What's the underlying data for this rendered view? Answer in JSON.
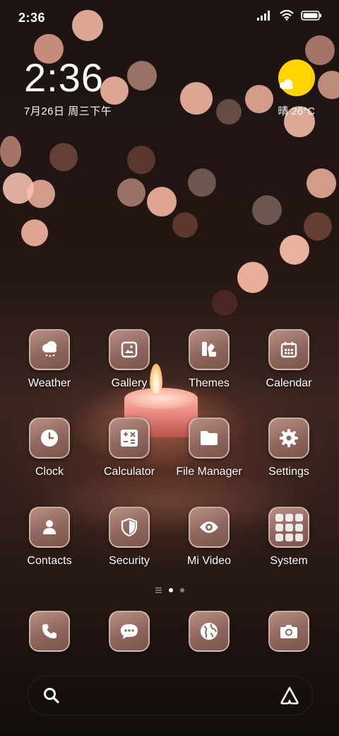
{
  "status_bar": {
    "time": "2:36",
    "icons": [
      "signal-icon",
      "wifi-icon",
      "battery-icon"
    ]
  },
  "clock_widget": {
    "time": "2:36",
    "date": "7月26日 周三下午"
  },
  "weather_widget": {
    "icon": "partly-sunny-icon",
    "text": "晴 26°C",
    "sun_color": "#ffd400"
  },
  "apps": {
    "weather": {
      "label": "Weather",
      "icon": "weather-cloud-icon"
    },
    "gallery": {
      "label": "Gallery",
      "icon": "gallery-icon"
    },
    "themes": {
      "label": "Themes",
      "icon": "themes-icon"
    },
    "calendar": {
      "label": "Calendar",
      "icon": "calendar-icon"
    },
    "clock": {
      "label": "Clock",
      "icon": "clock-icon"
    },
    "calculator": {
      "label": "Calculator",
      "icon": "calculator-icon"
    },
    "file_manager": {
      "label": "File Manager",
      "icon": "folder-icon"
    },
    "settings": {
      "label": "Settings",
      "icon": "gear-icon"
    },
    "contacts": {
      "label": "Contacts",
      "icon": "person-icon"
    },
    "security": {
      "label": "Security",
      "icon": "shield-icon"
    },
    "mi_video": {
      "label": "Mi Video",
      "icon": "eye-icon"
    },
    "system": {
      "label": "System",
      "icon": "folder-grid-icon"
    }
  },
  "page_indicator": {
    "pages": 2,
    "current": 1
  },
  "dock": [
    {
      "name": "phone",
      "icon": "phone-icon"
    },
    {
      "name": "messages",
      "icon": "chat-bubble-icon"
    },
    {
      "name": "browser",
      "icon": "globe-icon"
    },
    {
      "name": "camera",
      "icon": "camera-icon"
    }
  ],
  "search_bar": {
    "left_icon": "search-icon",
    "right_icon": "assistant-icon"
  }
}
